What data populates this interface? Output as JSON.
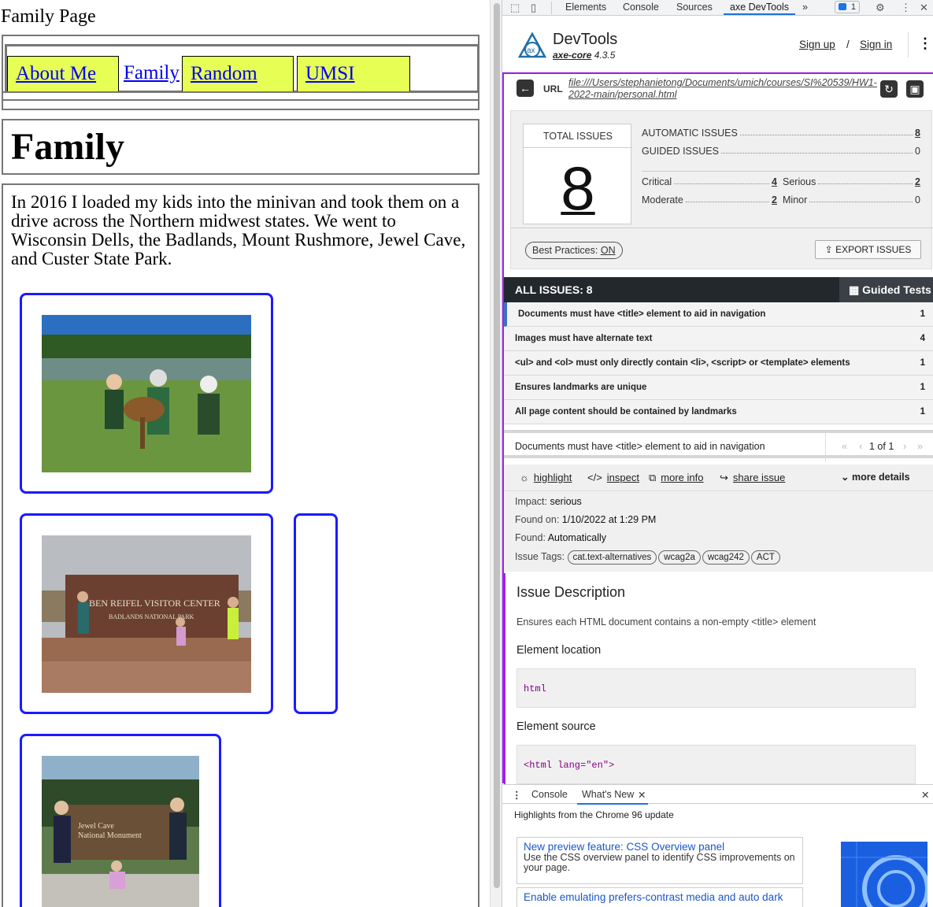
{
  "page": {
    "site_title": "Family Page",
    "nav": [
      "About Me",
      "Family",
      "Random",
      "UMSI"
    ],
    "heading": "Family",
    "intro": "In 2016 I loaded my kids into the minivan and took them on a drive across the Northern midwest states. We went to Wisconsin Dells, the Badlands, Mount Rushmore, Jewel Cave, and Custer State Park."
  },
  "devtools": {
    "tabs": [
      "Elements",
      "Console",
      "Sources",
      "axe DevTools"
    ],
    "more_tabs": "»",
    "badge": "1",
    "axe": {
      "title": "DevTools",
      "core_name": "axe-core",
      "core_version": "4.3.5",
      "sign_up": "Sign up",
      "separator": "/",
      "sign_in": "Sign in",
      "url_label": "URL",
      "url": "file:///Users/stephanietong/Documents/umich/courses/SI%20539/HW1-2022-main/personal.html",
      "total_label": "TOTAL ISSUES",
      "total": "8",
      "automatic_label": "AUTOMATIC ISSUES",
      "automatic": "8",
      "guided_label": "GUIDED ISSUES",
      "guided": "0",
      "critical_label": "Critical",
      "critical": "4",
      "serious_label": "Serious",
      "serious": "2",
      "moderate_label": "Moderate",
      "moderate": "2",
      "minor_label": "Minor",
      "minor": "0",
      "best_practices": "Best Practices:",
      "best_practices_state": "ON",
      "export": "EXPORT ISSUES",
      "all_issues": "ALL ISSUES: 8",
      "guided_tests": "Guided Tests",
      "issues": [
        {
          "name": "Documents must have <title> element to aid in navigation",
          "count": "1"
        },
        {
          "name": "Images must have alternate text",
          "count": "4"
        },
        {
          "name": "<ul> and <ol> must only directly contain <li>, <script> or <template> elements",
          "count": "1"
        },
        {
          "name": "Ensures landmarks are unique",
          "count": "1"
        },
        {
          "name": "All page content should be contained by landmarks",
          "count": "1"
        }
      ],
      "detail_title": "Documents must have <title> element to aid in navigation",
      "pager": "1 of 1",
      "actions": {
        "highlight": "highlight",
        "inspect": "inspect",
        "more_info": "more info",
        "share": "share issue",
        "more_details": "more details"
      },
      "impact_label": "Impact:",
      "impact": "serious",
      "found_on_label": "Found on:",
      "found_on": "1/10/2022 at 1:29 PM",
      "found_label": "Found:",
      "found": "Automatically",
      "tags_label": "Issue Tags:",
      "tags": [
        "cat.text-alternatives",
        "wcag2a",
        "wcag242",
        "ACT"
      ],
      "desc_heading": "Issue Description",
      "desc": "Ensures each HTML document contains a non-empty <title> element",
      "location_heading": "Element location",
      "location": "html",
      "source_heading": "Element source",
      "source": "<html lang=\"en\">"
    },
    "drawer": {
      "tabs": [
        "Console",
        "What's New"
      ],
      "headline": "Highlights from the Chrome 96 update",
      "cards": [
        {
          "title": "New preview feature: CSS Overview panel",
          "desc": "Use the CSS overview panel to identify CSS improvements on your page."
        },
        {
          "title": "Enable emulating prefers-contrast media and auto dark",
          "desc": ""
        }
      ]
    }
  }
}
